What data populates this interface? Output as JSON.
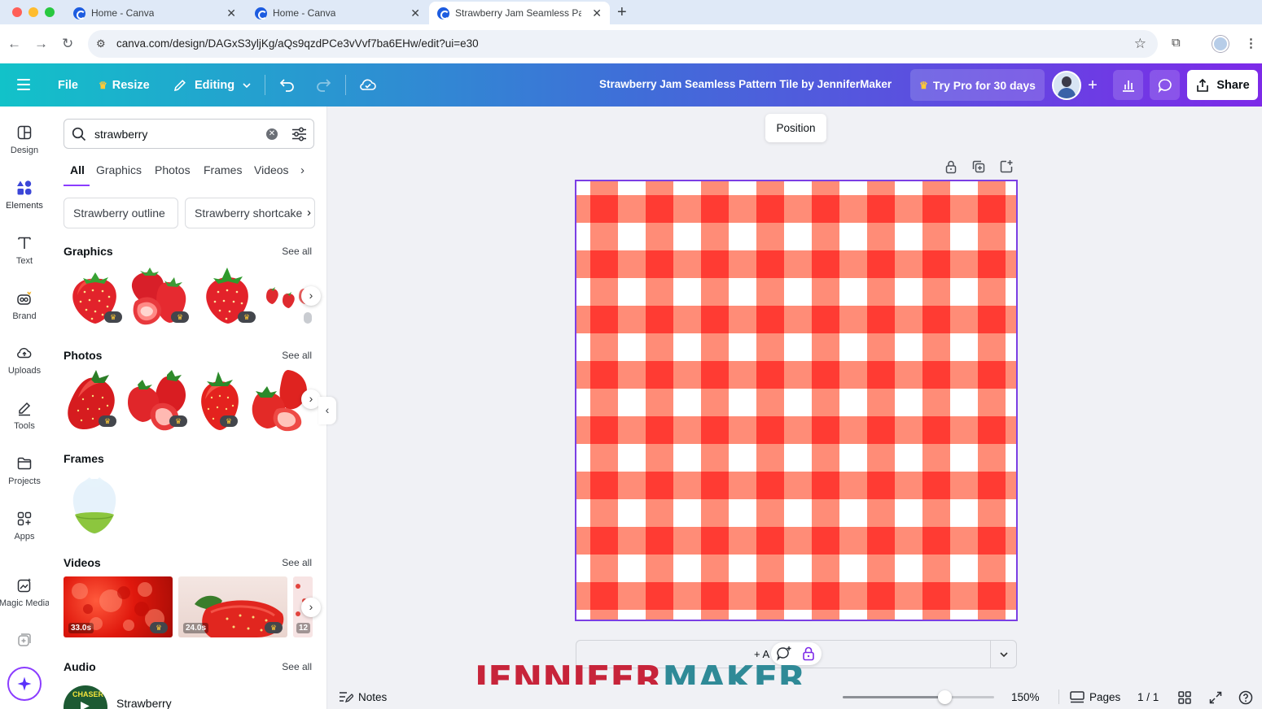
{
  "browser": {
    "tabs": [
      {
        "title": "Home - Canva",
        "active": false
      },
      {
        "title": "Home - Canva",
        "active": false
      },
      {
        "title": "Strawberry Jam Seamless Pa",
        "active": true
      }
    ],
    "url": "canva.com/design/DAGxS3yljKg/aQs9qzdPCe3vVvf7ba6EHw/edit?ui=e30"
  },
  "header": {
    "file_label": "File",
    "resize_label": "Resize",
    "editing_label": "Editing",
    "design_title": "Strawberry Jam Seamless Pattern Tile by JenniferMaker",
    "trypro_label": "Try Pro for 30 days",
    "share_label": "Share"
  },
  "rail": {
    "items": [
      {
        "label": "Design",
        "icon": "layout-icon"
      },
      {
        "label": "Elements",
        "icon": "shapes-icon",
        "active": true
      },
      {
        "label": "Text",
        "icon": "text-icon"
      },
      {
        "label": "Brand",
        "icon": "brand-icon"
      },
      {
        "label": "Uploads",
        "icon": "cloud-upload-icon"
      },
      {
        "label": "Tools",
        "icon": "pen-icon"
      },
      {
        "label": "Projects",
        "icon": "folder-icon"
      },
      {
        "label": "Apps",
        "icon": "apps-icon"
      },
      {
        "label": "Magic Media",
        "icon": "magic-media-icon"
      }
    ]
  },
  "panel": {
    "search_value": "strawberry",
    "tabs": [
      "All",
      "Graphics",
      "Photos",
      "Frames",
      "Videos"
    ],
    "chips": [
      "Strawberry outline",
      "Strawberry shortcake"
    ],
    "sections": {
      "graphics": "Graphics",
      "photos": "Photos",
      "frames": "Frames",
      "videos": "Videos",
      "audio": "Audio"
    },
    "see_all": "See all",
    "videos": [
      {
        "duration": "33.0s"
      },
      {
        "duration": "24.0s"
      },
      {
        "duration": "12"
      }
    ],
    "audio_track": "Strawberry",
    "audio_cover": "CHASER"
  },
  "canvas": {
    "position_label": "Position",
    "notes_add": "+ A"
  },
  "bottom": {
    "notes_label": "Notes",
    "zoom": "150%",
    "zoom_fraction": 0.67,
    "pages_label": "Pages",
    "pages_count": "1 / 1"
  },
  "watermark": {
    "part1": "JENNIFER",
    "part2": "MAKER"
  },
  "colors": {
    "gingham_dark": "#ff3b33",
    "gingham_light": "#ff8c77",
    "accent": "#8b3dff",
    "header_start": "#12c2c9",
    "header_end": "#7d2ae8"
  }
}
